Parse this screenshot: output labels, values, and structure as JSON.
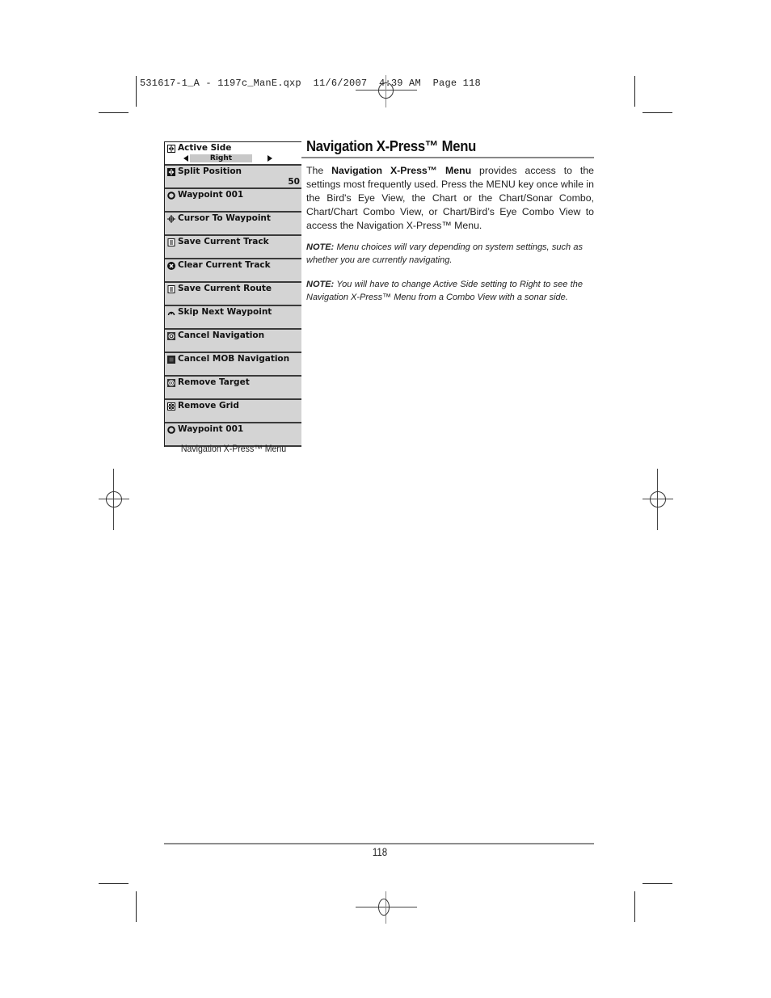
{
  "slug": {
    "text": "531617-1_A - 1197c_ManE.qxp  11/6/2007  4:39 AM  Page 118"
  },
  "figure": {
    "menu_items": [
      {
        "icon": "active-side-icon",
        "label": "Active Side",
        "selector_value": "Right",
        "active": true
      },
      {
        "icon": "split-position-icon",
        "label": "Split Position",
        "value": "50"
      },
      {
        "icon": "waypoint-icon",
        "label": "Waypoint 001"
      },
      {
        "icon": "crosshair-icon",
        "label": "Cursor To Waypoint"
      },
      {
        "icon": "save-icon",
        "label": "Save Current Track"
      },
      {
        "icon": "clear-icon",
        "label": "Clear Current Track"
      },
      {
        "icon": "save-icon",
        "label": "Save Current Route"
      },
      {
        "icon": "skip-icon",
        "label": "Skip Next Waypoint"
      },
      {
        "icon": "cancel-navigation-icon",
        "label": "Cancel Navigation"
      },
      {
        "icon": "cancel-mob-icon",
        "label": "Cancel MOB Navigation"
      },
      {
        "icon": "target-icon",
        "label": "Remove Target"
      },
      {
        "icon": "grid-icon",
        "label": "Remove Grid"
      },
      {
        "icon": "waypoint-icon",
        "label": "Waypoint 001"
      }
    ],
    "caption": "Navigation X-Press™ Menu"
  },
  "section": {
    "heading": "Navigation X-Press™ Menu",
    "intro_prefix": "The ",
    "intro_bold": "Navigation X-Press™ Menu",
    "intro_rest": " provides access to the settings most frequently used. Press the MENU key once while in the Bird's Eye View, the Chart or the Chart/Sonar Combo, Chart/Chart Combo View, or Chart/Bird’s Eye Combo View to access the Navigation X-Press™ Menu.",
    "notes": [
      {
        "label": "NOTE:",
        "text": " Menu choices will vary depending on system settings, such as whether you are currently navigating."
      },
      {
        "label": "NOTE:",
        "text": " You will have to change Active Side setting to Right to see the Navigation X-Press™ Menu from a Combo View with a sonar side."
      }
    ]
  },
  "footer": {
    "page_number": "118"
  }
}
